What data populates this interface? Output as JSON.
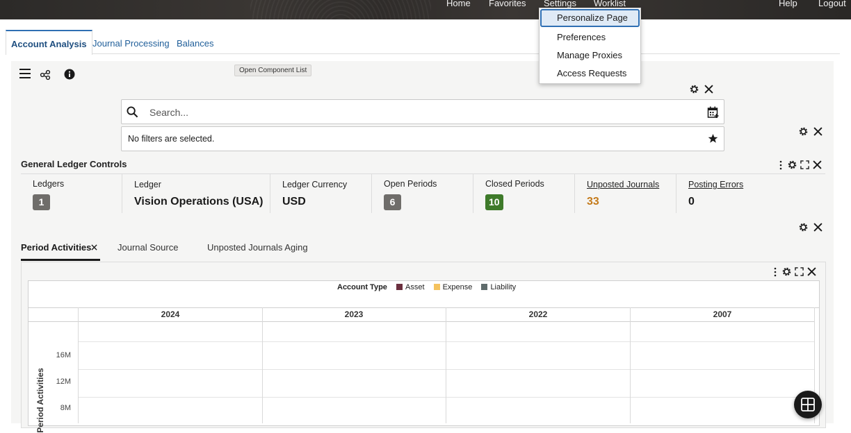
{
  "topnav": {
    "home": "Home",
    "favorites": "Favorites",
    "settings": "Settings",
    "worklist": "Worklist",
    "help": "Help",
    "logout": "Logout"
  },
  "settings_menu": {
    "items": [
      "Personalize Page",
      "Preferences",
      "Manage Proxies",
      "Access Requests"
    ],
    "active": "Personalize Page"
  },
  "tabs": [
    "Account Analysis",
    "Journal Processing",
    "Balances"
  ],
  "tooltip": "Open Component List",
  "search": {
    "placeholder": "Search..."
  },
  "filters": {
    "text": "No filters are selected."
  },
  "gl_controls": {
    "title": "General Ledger Controls",
    "ledgers_label": "Ledgers",
    "ledgers_value": "1",
    "ledger_label": "Ledger",
    "ledger_value": "Vision Operations (USA)",
    "currency_label": "Ledger Currency",
    "currency_value": "USD",
    "open_label": "Open Periods",
    "open_value": "6",
    "closed_label": "Closed Periods",
    "closed_value": "10",
    "unposted_label": "Unposted Journals",
    "unposted_value": "33",
    "errors_label": "Posting Errors",
    "errors_value": "0"
  },
  "sub_tabs": [
    "Period Activities",
    "Journal Source",
    "Unposted Journals Aging"
  ],
  "chart": {
    "legend_title": "Account Type",
    "legend": [
      {
        "name": "Asset",
        "color": "#6b2f3f"
      },
      {
        "name": "Expense",
        "color": "#f4c25e"
      },
      {
        "name": "Liability",
        "color": "#5f6b6b"
      }
    ],
    "years": [
      "2024",
      "2023",
      "2022",
      "2007"
    ],
    "y_ticks": [
      "16M",
      "12M",
      "8M"
    ],
    "y_title": "Period Activities"
  },
  "colors": {
    "badge_gray": "#6f6d6a",
    "badge_green": "#3e7a2a",
    "link_blue": "#1f5e99",
    "orange": "#c47a1a"
  }
}
